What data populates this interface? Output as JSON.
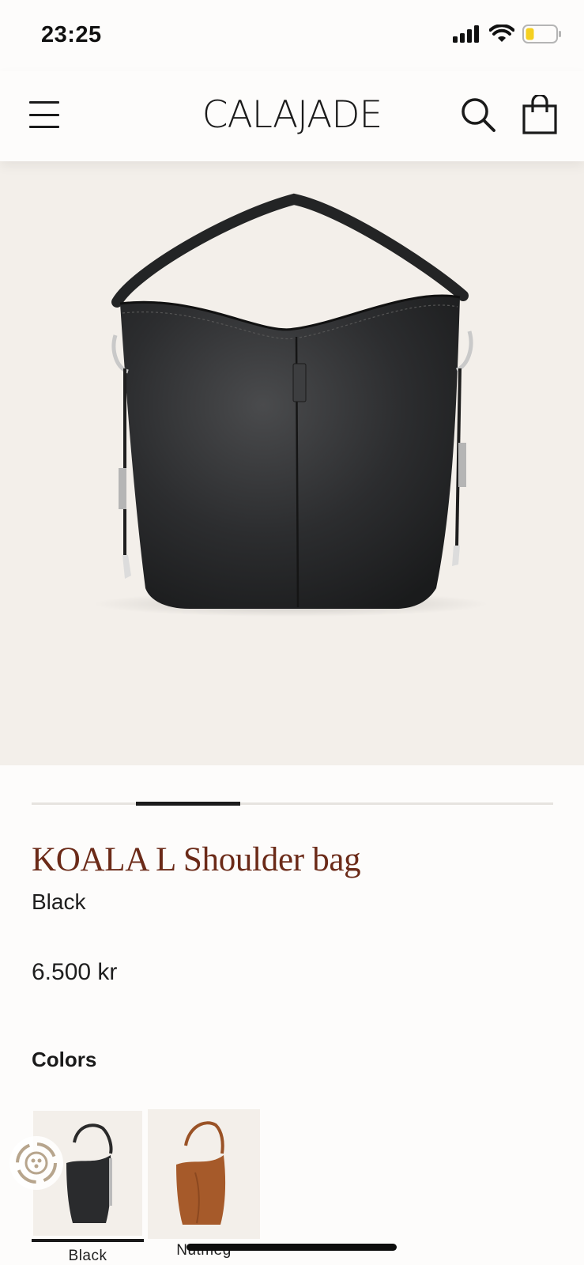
{
  "status_bar": {
    "time": "23:25",
    "icons": [
      "signal-icon",
      "wifi-icon",
      "battery-icon"
    ]
  },
  "header": {
    "brand": "CALAJADE",
    "icons": [
      "menu-icon",
      "search-icon",
      "shopping-bag-icon"
    ]
  },
  "gallery": {
    "image": "black-shoulder-bag-photo",
    "progress_fraction": 0.2
  },
  "product": {
    "title": "KOALA L Shoulder bag",
    "color": "Black",
    "price": "6.500 kr"
  },
  "colors": {
    "heading": "Colors",
    "options": [
      {
        "label": "Black",
        "selected": true
      },
      {
        "label": "Nutmeg",
        "selected": false
      }
    ]
  },
  "theme": {
    "title_color": "#6b2a18",
    "image_background": "#f3efea",
    "page_background": "#fdfcfb"
  }
}
